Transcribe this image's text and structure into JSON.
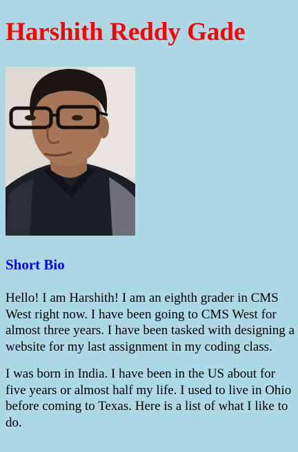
{
  "page": {
    "title": "Harshith Reddy Gade"
  },
  "colors": {
    "background": "#add8e6",
    "title": "#ff0000",
    "heading": "#0000ff",
    "text": "#000000"
  },
  "photo": {
    "icon": "portrait-photo"
  },
  "bio": {
    "heading": "Short Bio",
    "paragraphs": [
      "Hello! I am Harshith! I am an eighth grader in CMS West right now. I have been going to CMS West for almost three years. I have been tasked with designing a website for my last assignment in my coding class.",
      "I was born in India. I have been in the US about for five years or almost half my life. I used to live in Ohio before coming to Texas. Here is a list of what I like to do."
    ]
  }
}
